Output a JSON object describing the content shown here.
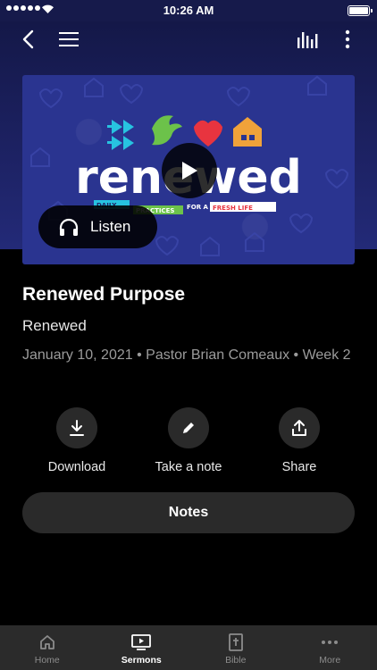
{
  "status_bar": {
    "time": "10:26 AM"
  },
  "artwork": {
    "title_text": "renewed",
    "tagline_left": "DAILY",
    "tagline_mid": "PRACTICES",
    "tagline_for": "FOR A",
    "tagline_right": "FRESH LIFE"
  },
  "listen": {
    "label": "Listen"
  },
  "sermon": {
    "title": "Renewed Purpose",
    "series": "Renewed",
    "meta": "January 10, 2021 • Pastor Brian Comeaux • Week 2"
  },
  "actions": [
    {
      "label": "Download",
      "icon": "download-icon"
    },
    {
      "label": "Take a note",
      "icon": "pencil-icon"
    },
    {
      "label": "Share",
      "icon": "share-icon"
    }
  ],
  "notes_button": {
    "label": "Notes"
  },
  "tabs": [
    {
      "label": "Home",
      "icon": "home-icon",
      "active": false
    },
    {
      "label": "Sermons",
      "icon": "video-icon",
      "active": true
    },
    {
      "label": "Bible",
      "icon": "bible-icon",
      "active": false
    },
    {
      "label": "More",
      "icon": "more-icon",
      "active": false
    }
  ],
  "colors": {
    "header": "#161a4b",
    "artwork": "#2a3490",
    "accent_red": "#e8343f",
    "accent_green": "#6cc24a",
    "accent_cyan": "#27c3e0",
    "accent_orange": "#f0a23a"
  }
}
